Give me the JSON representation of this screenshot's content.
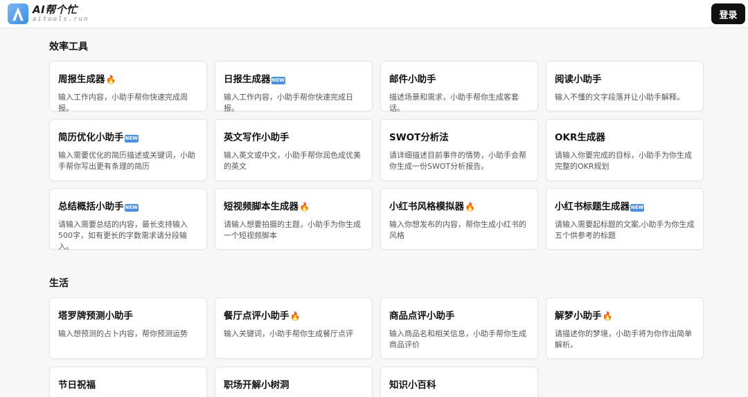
{
  "header": {
    "logo_title": "AI帮个忙",
    "logo_subtitle": "aitools.run",
    "login_label": "登录"
  },
  "sections": [
    {
      "title": "效率工具",
      "cards": [
        {
          "title": "周报生成器",
          "badge": "fire",
          "desc": "输入工作内容，小助手帮你快速完成周报。"
        },
        {
          "title": "日报生成器",
          "badge": "new",
          "desc": "输入工作内容，小助手帮你快速完成日报。"
        },
        {
          "title": "邮件小助手",
          "badge": "",
          "desc": "描述场景和需求，小助手帮你生成客套话。"
        },
        {
          "title": "阅读小助手",
          "badge": "",
          "desc": "输入不懂的文字段落并让小助手解释。"
        },
        {
          "title": "简历优化小助手",
          "badge": "new",
          "desc": "输入需要优化的简历描述或关键词，小助手帮你写出更有条理的简历"
        },
        {
          "title": "英文写作小助手",
          "badge": "",
          "desc": "输入英文或中文，小助手帮你润色成优美的英文"
        },
        {
          "title": "SWOT分析法",
          "badge": "",
          "desc": "请详细描述目前事件的情势，小助手会帮你生成一份SWOT分析报告。"
        },
        {
          "title": "OKR生成器",
          "badge": "",
          "desc": "请输入你要完成的目标，小助手为你生成完整的OKR规划"
        },
        {
          "title": "总结概括小助手",
          "badge": "new",
          "desc": "请输入需要总结的内容，最长支持输入500字，如有更长的字数需求请分段输入。"
        },
        {
          "title": "短视频脚本生成器",
          "badge": "fire",
          "desc": "请输入想要拍摄的主题，小助手为你生成一个短视频脚本"
        },
        {
          "title": "小红书风格模拟器",
          "badge": "fire",
          "desc": "输入你想发布的内容，帮你生成小红书的风格"
        },
        {
          "title": "小红书标题生成器",
          "badge": "new",
          "desc": "请输入需要起标题的文案,小助手为你生成五个供参考的标题"
        }
      ]
    },
    {
      "title": "生活",
      "cards": [
        {
          "title": "塔罗牌预测小助手",
          "badge": "",
          "desc": "输入想预测的占卜内容，帮你预测运势"
        },
        {
          "title": "餐厅点评小助手",
          "badge": "fire",
          "desc": "输入关键词，小助手帮你生成餐厅点评"
        },
        {
          "title": "商品点评小助手",
          "badge": "",
          "desc": "输入商品名和相关信息，小助手帮你生成商品评价"
        },
        {
          "title": "解梦小助手",
          "badge": "fire",
          "desc": "请描述你的梦境，小助手将为你作出简单解析。"
        },
        {
          "title": "节日祝福",
          "badge": "",
          "desc": ""
        },
        {
          "title": "职场开解小树洞",
          "badge": "",
          "desc": ""
        },
        {
          "title": "知识小百科",
          "badge": "",
          "desc": ""
        }
      ]
    }
  ],
  "badges": {
    "fire": "🔥",
    "new": "NEW"
  },
  "colors": {
    "accent": "#111111",
    "logo_blue": "#3d8de6",
    "new_badge": "#4a8fe0"
  }
}
